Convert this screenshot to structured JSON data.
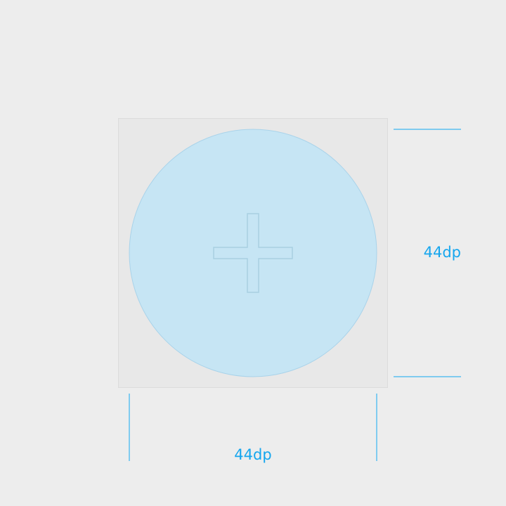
{
  "colors": {
    "background": "#EDEDED",
    "touch_target_fill": "#E8E8E8",
    "touch_target_border": "#DCDCDC",
    "circle_fill": "#C6E5F4",
    "circle_border": "#A9D3EA",
    "plus_icon_stroke": "#A8D0E2",
    "measure_line": "#5BC0F0",
    "measure_text": "#16A6EE"
  },
  "icons": {
    "center_icon": "plus-icon"
  },
  "dimensions": {
    "height_label": "44dp",
    "width_label": "44dp"
  }
}
